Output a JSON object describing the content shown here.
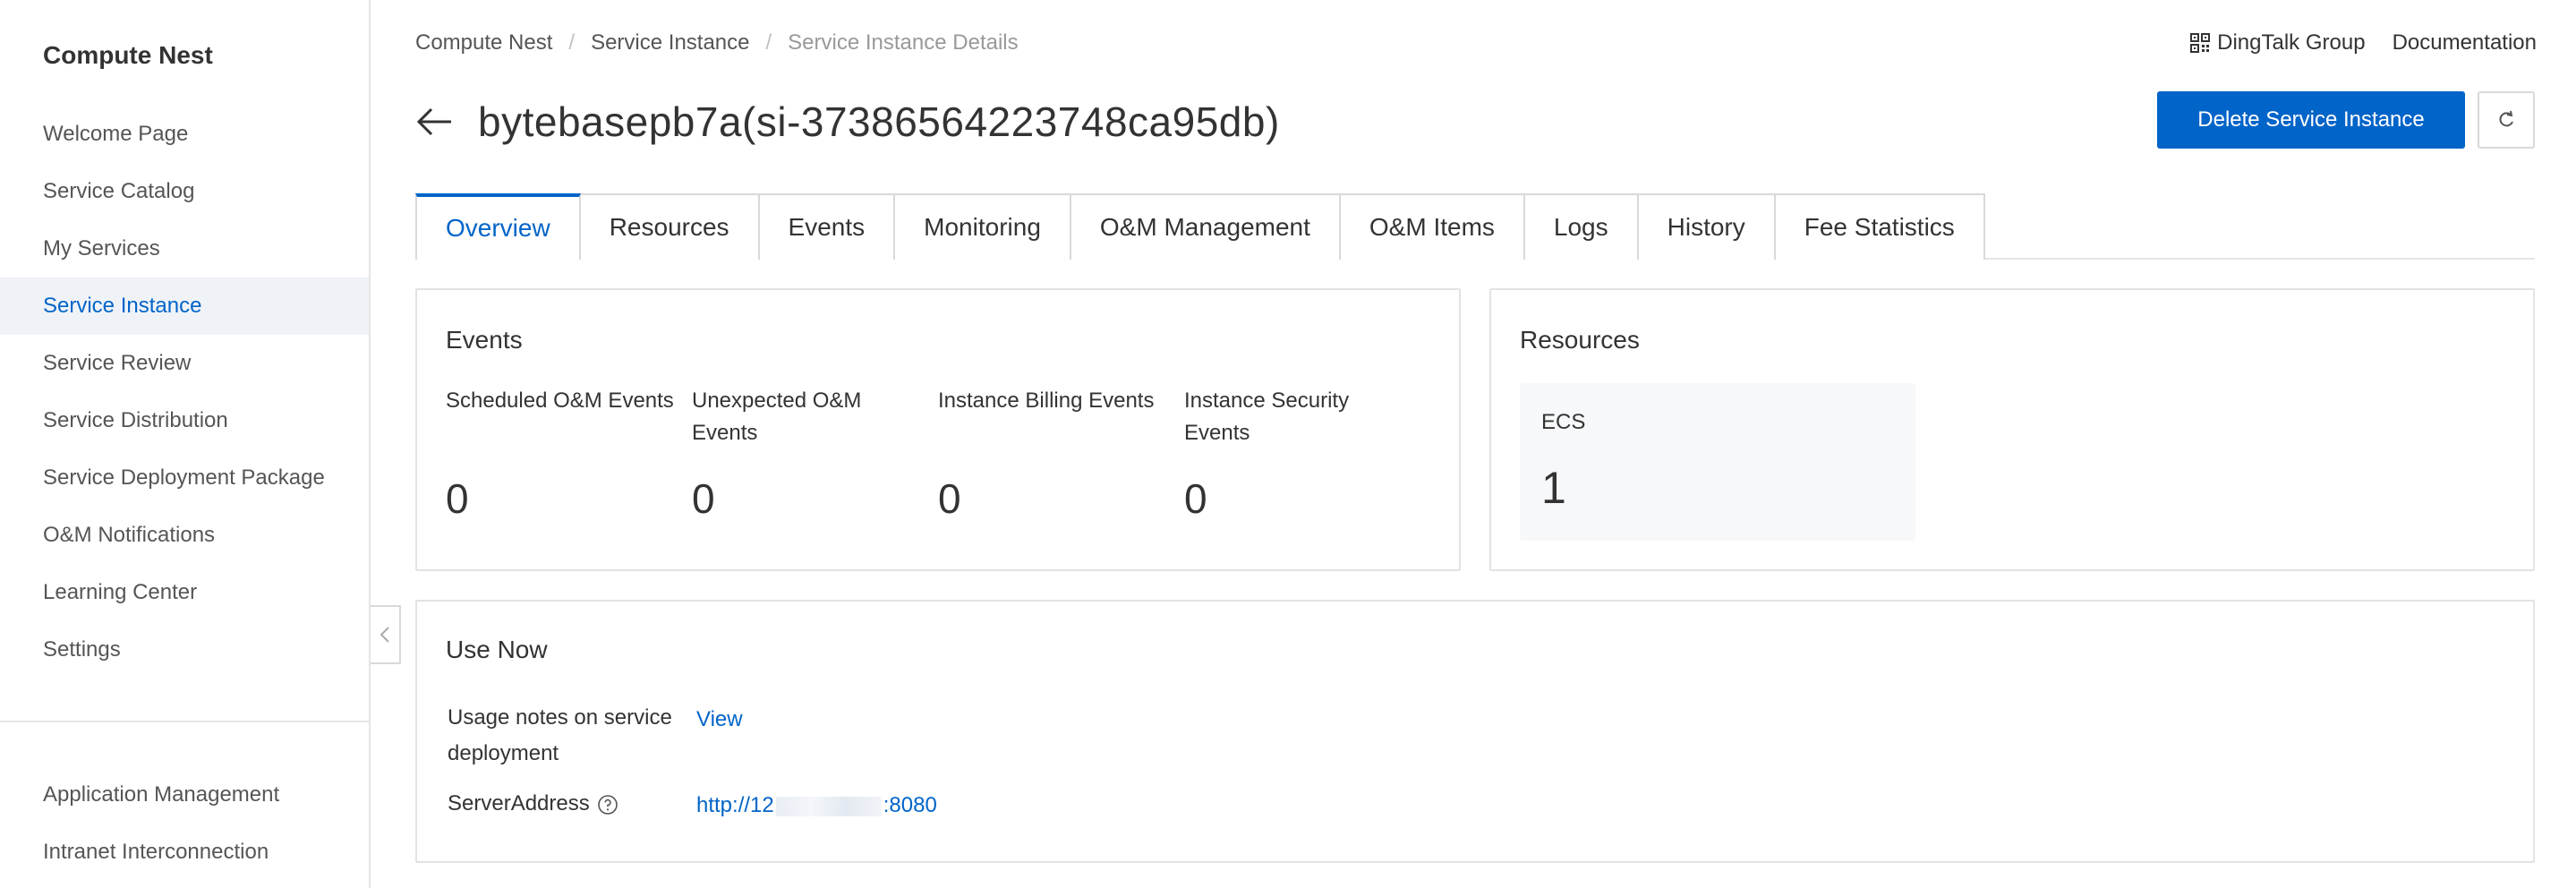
{
  "sidebar": {
    "title": "Compute Nest",
    "items": [
      {
        "label": "Welcome Page"
      },
      {
        "label": "Service Catalog"
      },
      {
        "label": "My Services"
      },
      {
        "label": "Service Instance"
      },
      {
        "label": "Service Review"
      },
      {
        "label": "Service Distribution"
      },
      {
        "label": "Service Deployment Package"
      },
      {
        "label": "O&M Notifications"
      },
      {
        "label": "Learning Center"
      },
      {
        "label": "Settings"
      }
    ],
    "active_item": "Service Instance",
    "bottom_items": [
      {
        "label": "Application Management"
      },
      {
        "label": "Intranet Interconnection"
      }
    ]
  },
  "header": {
    "breadcrumb": [
      "Compute Nest",
      "Service Instance",
      "Service Instance Details"
    ],
    "dingtalk_label": "DingTalk Group",
    "docs_label": "Documentation",
    "title": "bytebasepb7a(si-37386564223748ca95db)",
    "delete_label": "Delete Service Instance"
  },
  "tabs": [
    {
      "label": "Overview"
    },
    {
      "label": "Resources"
    },
    {
      "label": "Events"
    },
    {
      "label": "Monitoring"
    },
    {
      "label": "O&M Management"
    },
    {
      "label": "O&M Items"
    },
    {
      "label": "Logs"
    },
    {
      "label": "History"
    },
    {
      "label": "Fee Statistics"
    }
  ],
  "active_tab": "Overview",
  "events": {
    "title": "Events",
    "items": [
      {
        "label": "Scheduled O&M Events",
        "value": "0"
      },
      {
        "label": "Unexpected O&M Events",
        "value": "0"
      },
      {
        "label": "Instance Billing Events",
        "value": "0"
      },
      {
        "label": "Instance Security Events",
        "value": "0"
      }
    ]
  },
  "resources": {
    "title": "Resources",
    "items": [
      {
        "label": "ECS",
        "value": "1"
      }
    ]
  },
  "use_now": {
    "title": "Use Now",
    "usage_label": "Usage notes on service deployment",
    "usage_link": "View",
    "server_label": "ServerAddress",
    "server_prefix": "http://12",
    "server_suffix": ":8080"
  },
  "colors": {
    "accent": "#0064c8",
    "active_bg": "#eff3f8",
    "border": "#e3e3e3"
  }
}
